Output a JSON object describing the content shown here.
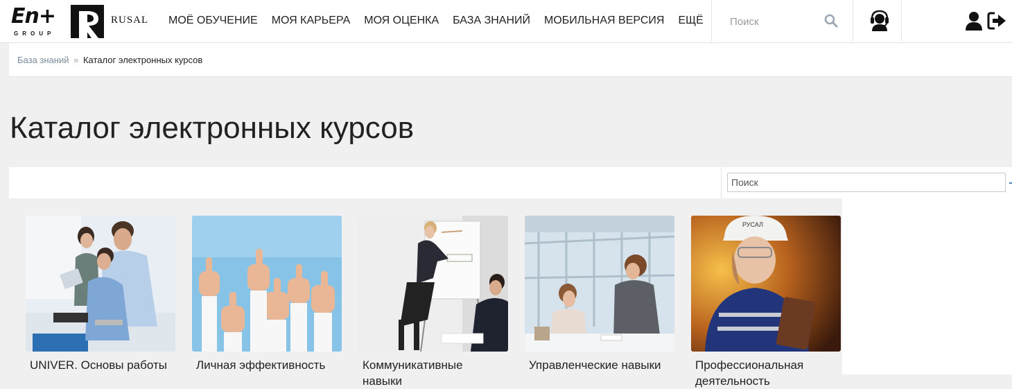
{
  "header": {
    "logo_enplus": "En+",
    "logo_enplus_sub": "GROUP",
    "logo_rusal": "RUSAL",
    "nav": [
      {
        "label": "МОЁ ОБУЧЕНИЕ"
      },
      {
        "label": "МОЯ КАРЬЕРА"
      },
      {
        "label": "МОЯ ОЦЕНКА"
      },
      {
        "label": "БАЗА ЗНАНИЙ"
      },
      {
        "label": "МОБИЛЬНАЯ ВЕРСИЯ"
      },
      {
        "label": "ЕЩЁ"
      }
    ],
    "search_placeholder": "Поиск",
    "icons": {
      "search": "search-icon",
      "support": "headset-support-icon",
      "user": "user-icon",
      "logout": "logout-icon"
    }
  },
  "breadcrumb": {
    "parent": "База знаний",
    "separator": "»",
    "current": "Каталог электронных курсов"
  },
  "page": {
    "title": "Каталог электронных курсов",
    "search_placeholder": "Поиск"
  },
  "courses": [
    {
      "title": "UNIVER. Основы работы",
      "image": "office-team-at-computer-photo"
    },
    {
      "title": "Личная эффективность",
      "image": "thumbs-up-hands-photo"
    },
    {
      "title": "Коммуникативные навыки",
      "image": "presentation-flipchart-photo"
    },
    {
      "title": "Управленческие навыки",
      "image": "business-meeting-photo"
    },
    {
      "title": "Профессиональная деятельность",
      "image": "rusal-worker-helmet-photo",
      "image_text": "РУСАЛ"
    }
  ],
  "colors": {
    "background": "#f0f0f0",
    "panel": "#ffffff",
    "breadcrumb_link": "#7a8a99",
    "accent": "#4a7fb8"
  }
}
